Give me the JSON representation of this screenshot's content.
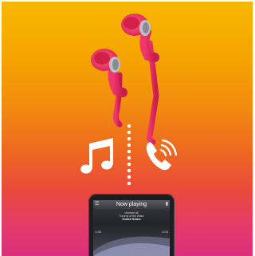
{
  "colors": {
    "background_top": "#f7b800",
    "background_bottom": "#dc2f7c",
    "earphone": "#f1336e",
    "icons": "#ffffff"
  },
  "icons": [
    "earphones-icon",
    "music-note-icon",
    "phone-call-icon",
    "smartphone-icon"
  ],
  "phone": {
    "header": "Now playing",
    "track_line1": "Unravel all",
    "track_line2": "Tommy of the Bass",
    "track_title": "Come Home",
    "time_elapsed": "1:38",
    "time_remaining": "4:03"
  }
}
